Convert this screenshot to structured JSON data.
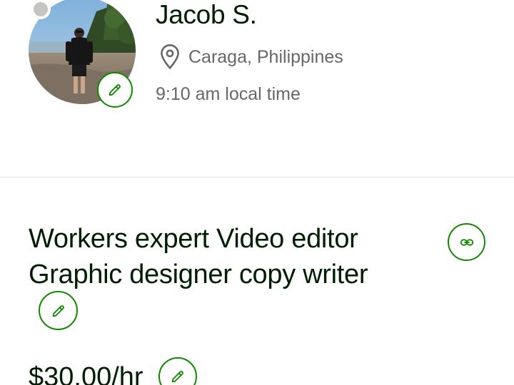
{
  "profile": {
    "name": "Jacob S.",
    "location": "Caraga, Philippines",
    "local_time": "9:10 am local time",
    "status": "offline",
    "icons": {
      "location": "map-pin-icon",
      "edit": "pencil-icon"
    }
  },
  "headline": {
    "title": "Workers expert Video editor Graphic designer copy writer",
    "hourly_rate": "$30.00/hr",
    "icons": {
      "share": "link-icon",
      "edit": "pencil-icon"
    }
  },
  "colors": {
    "accent": "#108a00",
    "text": "#001e00",
    "muted": "#676767",
    "divider": "#e4e6e4"
  }
}
